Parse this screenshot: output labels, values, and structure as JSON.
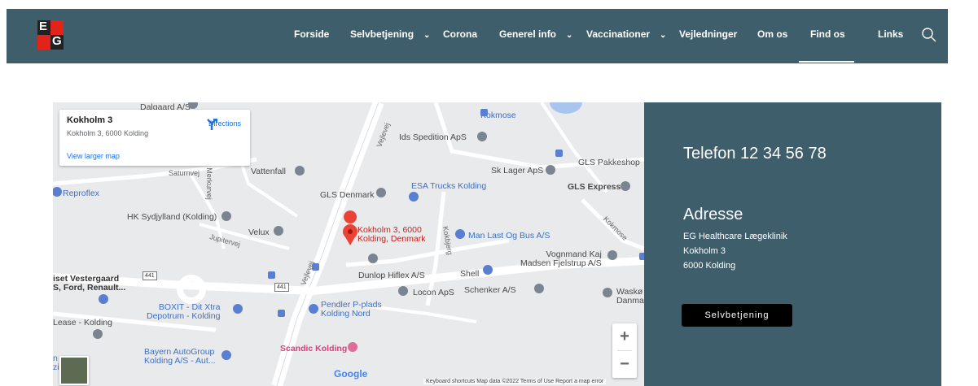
{
  "colors": {
    "navbar_bg": "#3f5e6c",
    "logo_red": "#e2231a",
    "logo_dark": "#222222",
    "info_bg": "#3f5e6c",
    "button_bg": "#000000"
  },
  "logo": {
    "top": "E",
    "bottom": "G"
  },
  "nav": {
    "items": [
      {
        "label": "Forside",
        "dropdown": false
      },
      {
        "label": "Selvbetjening",
        "dropdown": true
      },
      {
        "label": "Corona",
        "dropdown": false
      },
      {
        "label": "Generel info",
        "dropdown": true
      },
      {
        "label": "Vaccinationer",
        "dropdown": true
      },
      {
        "label": "Vejledninger",
        "dropdown": false
      },
      {
        "label": "Om os",
        "dropdown": false
      },
      {
        "label": "Find os",
        "dropdown": false,
        "active": true
      },
      {
        "label": "Links",
        "dropdown": false
      }
    ],
    "chevron": "⌄",
    "search_icon": "search-icon"
  },
  "map": {
    "card": {
      "title": "Kokholm 3",
      "subtitle": "Kokholm 3, 6000 Kolding",
      "directions_label": "Directions",
      "larger_map_label": "View larger map"
    },
    "pois": {
      "dalgaard": "Dalgaard A/S",
      "kokmose_top": "Kokmose",
      "ids": "Ids Spedition ApS",
      "vattenfall": "Vattenfall",
      "sk_lager": "Sk Lager ApS",
      "gls_pakkeshop": "GLS Pakkeshop",
      "reproflex": "Reproflex",
      "gls_denmark": "GLS Denmark",
      "esa": "ESA Trucks Kolding",
      "gls_express": "GLS Express",
      "hk": "HK Sydjylland (Kolding)",
      "velux": "Velux",
      "pin_line1": "Kokholm 3, 6000",
      "pin_line2": "Kolding, Denmark",
      "man_bus": "Man Last Og Bus A/S",
      "vognmand_line1": "Vognmand Kaj",
      "vognmand_line2": "Madsen Fjelstrup A/S",
      "dunlop": "Dunlop Hiflex A/S",
      "shell": "Shell",
      "vestergaard_line1": "iset Vestergaard",
      "vestergaard_line2": "S, Ford, Renault...",
      "locon": "Locon ApS",
      "schenker": "Schenker A/S",
      "waskoe_line1": "Waskø",
      "waskoe_line2": "Danma",
      "boxit_line1": "BOXIT - Dit Xtra",
      "boxit_line2": "Depotrum - Kolding",
      "pendler_line1": "Pendler P-plads",
      "pendler_line2": "Kolding Nord",
      "lease": "Lease - Kolding",
      "scandic": "Scandic Kolding",
      "bayern_line1": "Bayern AutoGroup",
      "bayern_line2": "Kolding A/S - Aut...",
      "left_edge_1": "n",
      "left_edge_2": "zi"
    },
    "roads": {
      "vejlevej_top": "Vejlevej",
      "vejlevej_mid": "Vejlevej",
      "saturnvej": "Saturnvej",
      "merkurvej": "Merkurvej",
      "jupitervej": "Jupitervej",
      "kokbjerg": "Kokbjerg",
      "kokmose_side": "Kokmose"
    },
    "exit_badges": [
      "441",
      "441"
    ],
    "zoom_in": "+",
    "zoom_out": "−",
    "google": "Google",
    "attribution": "Keyboard shortcuts    Map data ©2022    Terms of Use    Report a map error"
  },
  "info": {
    "phone": "Telefon 12 34 56 78",
    "address_heading": "Adresse",
    "address_lines": [
      "EG Healthcare Lægeklinik",
      "Kokholm 3",
      "6000 Kolding"
    ],
    "button_label": "Selvbetjening"
  }
}
